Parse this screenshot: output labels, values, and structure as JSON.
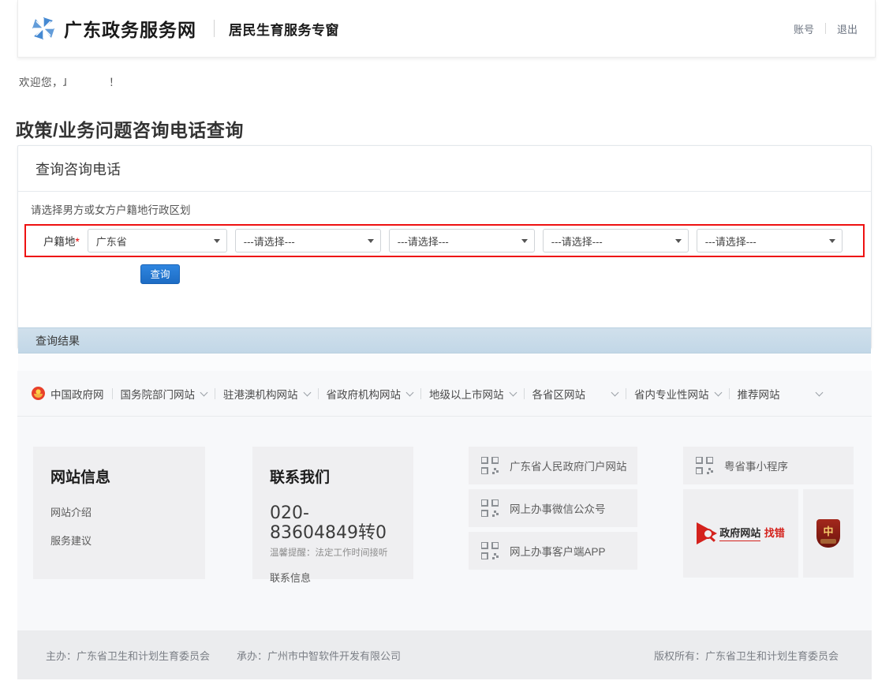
{
  "header": {
    "logo_icon": "pinwheel-logo-icon",
    "brand_name": "广东政务服务网",
    "brand_sub": "居民生育服务专窗",
    "account_label": "账号",
    "logout_label": "退出"
  },
  "welcome": {
    "prefix": "欢迎您，",
    "user": "ɺ",
    "suffix": "！"
  },
  "page_title": "政策/业务问题咨询电话查询",
  "panel": {
    "title": "查询咨询电话",
    "hint": "请选择男方或女方户籍地行政区划",
    "field_label": "户籍地",
    "required_mark": "*",
    "selects": [
      {
        "value": "广东省"
      },
      {
        "value": "---请选择---"
      },
      {
        "value": "---请选择---"
      },
      {
        "value": "---请选择---"
      },
      {
        "value": "---请选择---"
      }
    ],
    "query_button": "查询",
    "result_title": "查询结果",
    "result_body": ""
  },
  "links_bar": {
    "emblem_icon": "national-emblem-icon",
    "first_link": "中国政府网",
    "items": [
      {
        "label": "国务院部门网站",
        "has_chevron": true
      },
      {
        "label": "驻港澳机构网站",
        "has_chevron": true
      },
      {
        "label": "省政府机构网站",
        "has_chevron": true
      },
      {
        "label": "地级以上市网站",
        "has_chevron": true
      },
      {
        "label": "各省区网站",
        "has_chevron": true
      },
      {
        "label": "省内专业性网站",
        "has_chevron": true
      },
      {
        "label": "推荐网站",
        "has_chevron": true
      }
    ]
  },
  "footer_cards": {
    "site_info": {
      "title": "网站信息",
      "links": [
        "网站介绍",
        "服务建议"
      ]
    },
    "contact": {
      "title": "联系我们",
      "phone": "020-83604849转0",
      "tip": "温馨提醒：法定工作时间接听",
      "link": "联系信息"
    },
    "qr_items": [
      {
        "icon": "qr-code-icon",
        "label": "广东省人民政府门户网站"
      },
      {
        "icon": "qr-code-icon",
        "label": "网上办事微信公众号"
      },
      {
        "icon": "qr-code-icon",
        "label": "网上办事客户端APP"
      }
    ],
    "qr_items_right": [
      {
        "icon": "qr-code-icon",
        "label": "粤省事小程序"
      }
    ],
    "badges": [
      {
        "icon": "gov-website-error-report-icon",
        "line1": "政府网站",
        "line2": "找错"
      },
      {
        "icon": "gov-shield-badge-icon",
        "mark": "中"
      }
    ]
  },
  "bottom_bar": {
    "host": "主办：广东省卫生和计划生育委员会",
    "operator": "承办：广州市中智软件开发有限公司",
    "copyright": "版权所有：广东省卫生和计划生育委员会"
  },
  "colors": {
    "brand_blue": "#3b83d0",
    "button_blue": "#2277d4",
    "highlight_red": "#ee1111",
    "result_header": "#c9dcea",
    "card_gray": "#efeff1"
  }
}
